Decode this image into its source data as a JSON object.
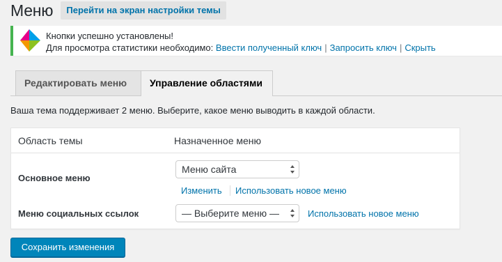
{
  "header": {
    "title": "Меню",
    "action_label": "Перейти на экран настройки темы"
  },
  "notice": {
    "line1": "Кнопки успешно установлены!",
    "line2_prefix": "Для просмотра статистики необходимо:",
    "link_enter_key": "Ввести полученный ключ",
    "link_request_key": "Запросить ключ",
    "link_hide": "Скрыть",
    "separator": "|",
    "border_color": "#46b450",
    "logo_colors": [
      "#e5008a",
      "#00a0e9",
      "#8dc21f",
      "#f39800"
    ]
  },
  "tabs": [
    {
      "label": "Редактировать меню",
      "active": false
    },
    {
      "label": "Управление областями",
      "active": true
    }
  ],
  "description": "Ваша тема поддерживает 2 меню. Выберите, какое меню выводить в каждой области.",
  "table": {
    "col_location": "Область темы",
    "col_menu": "Назначенное меню",
    "rows": [
      {
        "label": "Основное меню",
        "selected": "Меню сайта",
        "edit_link": "Изменить",
        "new_link": "Использовать новое меню"
      },
      {
        "label": "Меню социальных ссылок",
        "selected": "— Выберите меню —",
        "new_link": "Использовать новое меню"
      }
    ]
  },
  "save_label": "Сохранить изменения",
  "colors": {
    "link": "#0073aa",
    "primary_button": "#0085ba"
  }
}
